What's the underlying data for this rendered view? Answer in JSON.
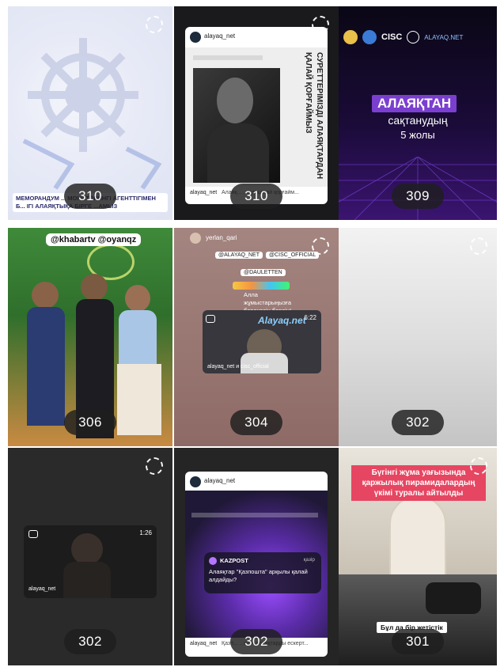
{
  "posts": [
    {
      "count": "310",
      "caption": "МЕМОРАНДУМ ... МОНИТОРИНГІ АГЕНТТІГІМЕН Б... ІГІ АЛАЯҚТЫҚА БІРГЕ ...АМЫЗ"
    },
    {
      "count": "310",
      "account": "alayaq_net",
      "vertical_title": "СУРЕТТЕРІМІЗДІ АЛАЯҚТАРДАН ҚАЛАЙ ҚОРҒАЙМЫЗ",
      "caption_user": "alayaq_net",
      "caption": "Алаяқ... ...ізді қалай қорғайм..."
    },
    {
      "count": "309",
      "logos": [
        "CISC",
        "ALAYAQ.NET"
      ],
      "title": "АЛАЯҚТАН",
      "subtitle": "сақтанудың",
      "subtitle2": "5 жолы"
    },
    {
      "count": "306",
      "tag": "@khabartv @oyanqz"
    },
    {
      "count": "304",
      "user": "yerlan_qari",
      "mention1": "@ALAYAQ_NET",
      "mention2": "@CISC_OFFICIAL",
      "mention3": "@DAULETTEN",
      "message": "Алла жұмыстарыңызға берекесін берсін!",
      "video_brand": "Alayaq.net",
      "duration": "6:22",
      "video_caption": "alayaq_net и cisc_official"
    },
    {
      "count": "302"
    },
    {
      "count": "302",
      "duration": "1:26",
      "video_caption": "alayaq_net"
    },
    {
      "count": "302",
      "account": "alayaq_net",
      "source": "KAZPOST",
      "source_time": "қазір",
      "headline": "Алаяқтар \"Қазпошта\" арқылы қалай алдайды?",
      "caption_user": "alayaq_net",
      "caption": "Қазп... ...етін алаяқтарды ескерт..."
    },
    {
      "count": "301",
      "banner": "Бүгінгі жұма уағызында қаржылық пирамидалардың үкімі туралы айтылды",
      "bottom_label": "Бұл да бір жетістік"
    }
  ]
}
